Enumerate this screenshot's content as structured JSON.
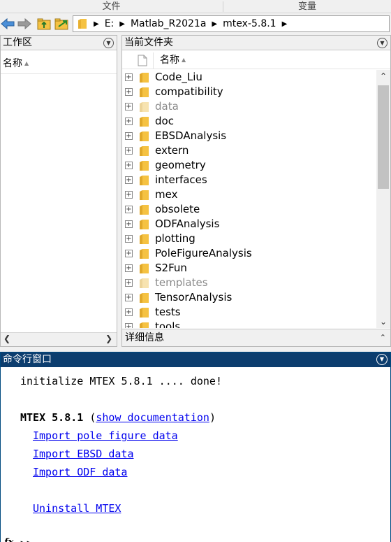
{
  "header": {
    "tab_files": "文件",
    "tab_vars": "变量"
  },
  "address": {
    "segments": [
      "E:",
      "Matlab_R2021a",
      "mtex-5.8.1"
    ]
  },
  "workspace": {
    "title": "工作区",
    "col_name": "名称"
  },
  "current_folder": {
    "title": "当前文件夹",
    "col_name": "名称",
    "items": [
      {
        "name": "Code_Liu",
        "dim": false
      },
      {
        "name": "compatibility",
        "dim": false
      },
      {
        "name": "data",
        "dim": true
      },
      {
        "name": "doc",
        "dim": false
      },
      {
        "name": "EBSDAnalysis",
        "dim": false
      },
      {
        "name": "extern",
        "dim": false
      },
      {
        "name": "geometry",
        "dim": false
      },
      {
        "name": "interfaces",
        "dim": false
      },
      {
        "name": "mex",
        "dim": false
      },
      {
        "name": "obsolete",
        "dim": false
      },
      {
        "name": "ODFAnalysis",
        "dim": false
      },
      {
        "name": "plotting",
        "dim": false
      },
      {
        "name": "PoleFigureAnalysis",
        "dim": false
      },
      {
        "name": "S2Fun",
        "dim": false
      },
      {
        "name": "templates",
        "dim": true
      },
      {
        "name": "TensorAnalysis",
        "dim": false
      },
      {
        "name": "tests",
        "dim": false
      },
      {
        "name": "tools",
        "dim": false
      }
    ],
    "details_title": "详细信息"
  },
  "command_window": {
    "title": "命令行窗口",
    "init_line": "initialize MTEX 5.8.1  .... done!",
    "mtex_label": "MTEX 5.8.1",
    "doc_open": "(",
    "doc_link": "show documentation",
    "doc_close": ")",
    "links": [
      "Import pole figure data",
      "Import EBSD data",
      "Import ODF data"
    ],
    "uninstall": "Uninstall MTEX",
    "prompt_fx": "fx",
    "prompt": ">>"
  },
  "colors": {
    "accent_header": "#0c3d6e",
    "folder": "#f5c242",
    "link": "#0000ee"
  }
}
